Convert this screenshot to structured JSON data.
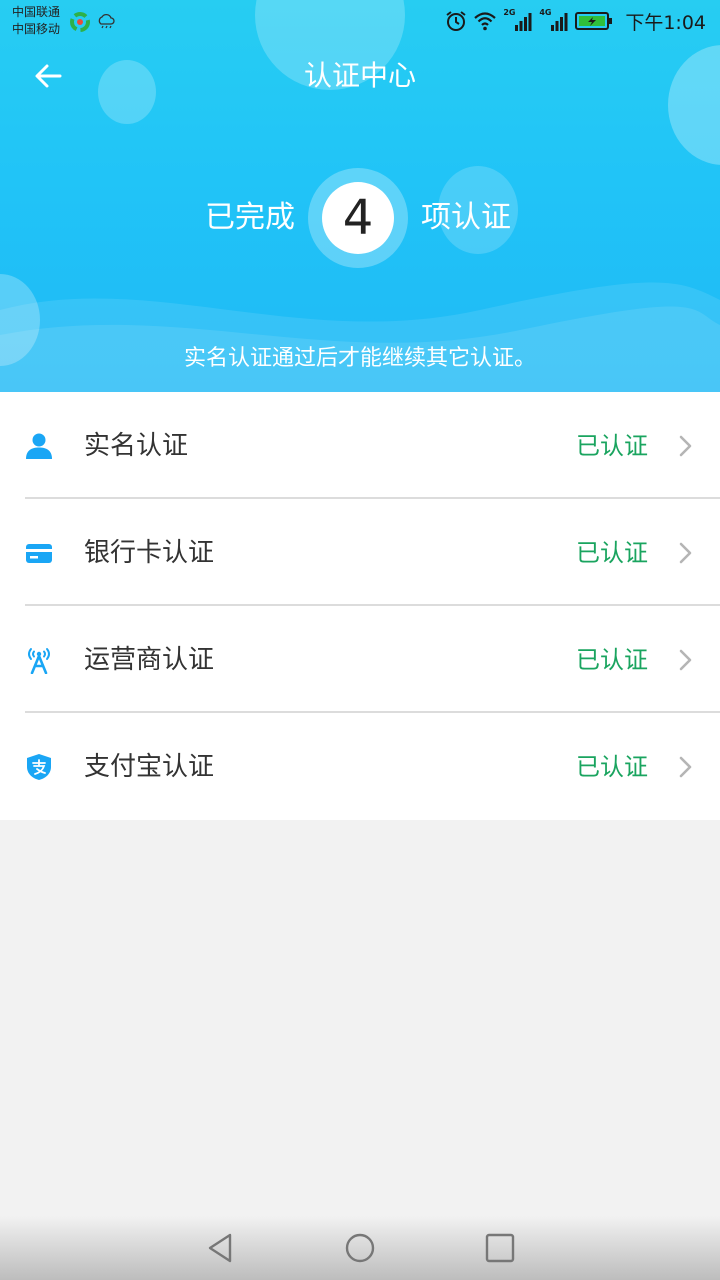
{
  "status_bar": {
    "carrier1": "中国联通",
    "carrier2": "中国移动",
    "signal1_label": "2G",
    "signal2_label": "4G",
    "time": "下午1:04"
  },
  "nav": {
    "title": "认证中心"
  },
  "summary": {
    "prefix": "已完成",
    "count": "4",
    "suffix": "项认证",
    "hint": "实名认证通过后才能继续其它认证。"
  },
  "items": [
    {
      "label": "实名认证",
      "status": "已认证",
      "icon": "person-icon"
    },
    {
      "label": "银行卡认证",
      "status": "已认证",
      "icon": "bank-card-icon"
    },
    {
      "label": "运营商认证",
      "status": "已认证",
      "icon": "signal-tower-icon"
    },
    {
      "label": "支付宝认证",
      "status": "已认证",
      "icon": "alipay-shield-icon"
    }
  ],
  "colors": {
    "header": "#21c4f7",
    "accent_icon": "#1aa6f5",
    "status_verified": "#1aa45f"
  }
}
